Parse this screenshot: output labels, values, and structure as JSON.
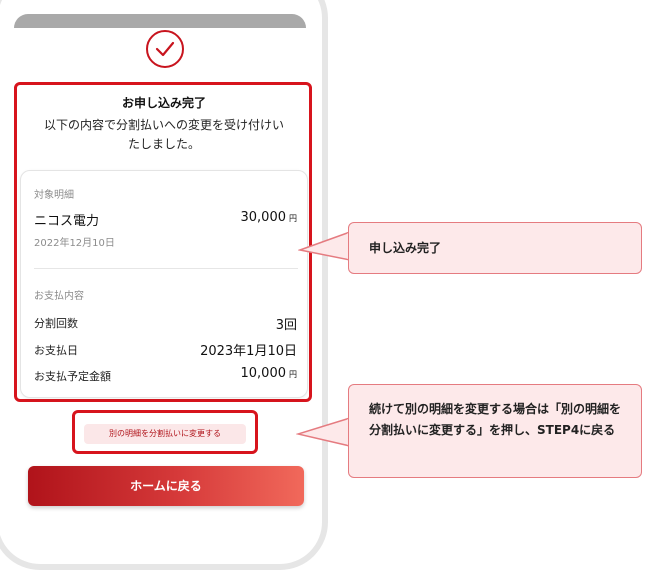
{
  "complete": {
    "title": "お申し込み完了",
    "message": "以下の内容で分割払いへの変更を受け付けいたしました。"
  },
  "detail": {
    "target_label": "対象明細",
    "merchant": "ニコス電力",
    "amount": "30,000",
    "amount_unit": "円",
    "date": "2022年12月10日",
    "payment_label": "お支払内容",
    "rows": [
      {
        "label": "分割回数",
        "value": "3回",
        "unit": ""
      },
      {
        "label": "お支払日",
        "value": "2023年1月10日",
        "unit": ""
      },
      {
        "label": "お支払予定金額",
        "value": "10,000",
        "unit": "円"
      }
    ]
  },
  "buttons": {
    "another": "別の明細を分割払いに変更する",
    "home": "ホームに戻る"
  },
  "callouts": {
    "first": "申し込み完了",
    "second": "続けて別の明細を変更する場合は「別の明細を分割払いに変更する」を押し、STEP4に戻る"
  },
  "icons": {
    "complete": "checkmark-circle-icon"
  },
  "colors": {
    "accent": "#d7141d",
    "callout_bg": "#fde9ea",
    "callout_border": "#e57b80"
  }
}
